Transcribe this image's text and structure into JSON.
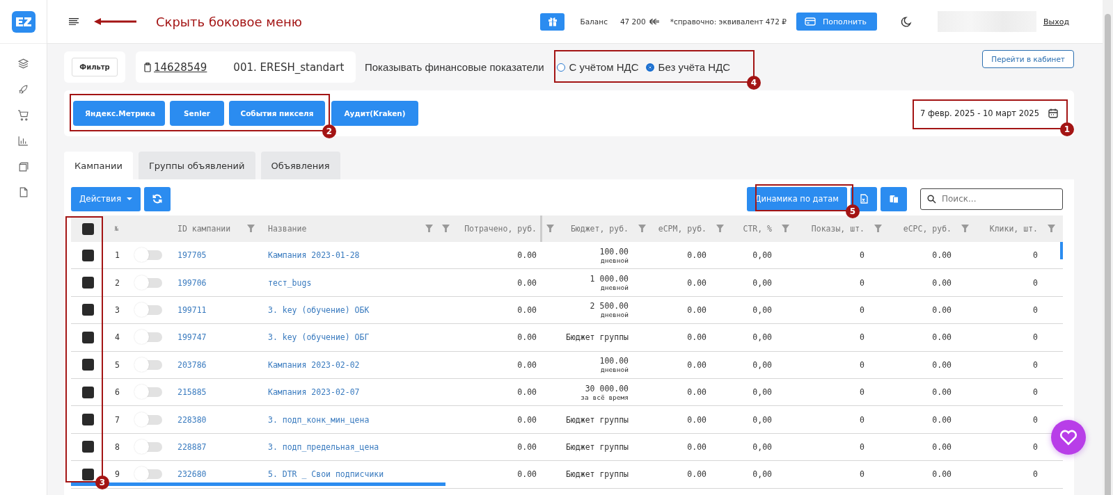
{
  "topbar": {
    "hint": "Скрыть боковое меню",
    "balance_label": "Баланс",
    "balance_value": "47 200",
    "reference_note": "*справочно: эквивалент 472 ₽",
    "topup_button": "Пополнить",
    "logout_link": "Выход"
  },
  "filter_button": "Фильтр",
  "account": {
    "id": "14628549",
    "name": "001. ERESH_standart"
  },
  "finance_display": {
    "label": "Показывать финансовые показатели",
    "options": [
      {
        "label": "С учётом НДС",
        "selected": false
      },
      {
        "label": "Без учёта НДС",
        "selected": true
      }
    ]
  },
  "cabinet_button": "Перейти в кабинет",
  "integration_buttons": [
    "Яндекс.Метрика",
    "Senler",
    "События пикселя",
    "Аудит(Kraken)"
  ],
  "date_range": "7 февр. 2025 - 10 март 2025",
  "tabs": [
    {
      "label": "Кампании",
      "selected": true
    },
    {
      "label": "Группы объявлений",
      "selected": false
    },
    {
      "label": "Объявления",
      "selected": false
    }
  ],
  "actions_button": "Действия",
  "dynamics_button": "Динамика по датам",
  "search": {
    "placeholder": "Поиск..."
  },
  "table": {
    "columns": [
      "№",
      "ID кампании",
      "Название",
      "Потрачено, руб.",
      "Бюджет, руб.",
      "eCPM, руб.",
      "CTR, %",
      "Показы, шт.",
      "eCPC, руб.",
      "Клики, шт."
    ],
    "all_checked": false,
    "rows": [
      {
        "num": "1",
        "checked": false,
        "on": false,
        "id": "197705",
        "name": "Кампания 2023-01-28",
        "spent": "0.00",
        "budget": "100.00",
        "budget_period": "дневной",
        "ecpm": "0.00",
        "ctr": "0,00",
        "shows": "0",
        "ecpc": "0.00",
        "clicks": "0"
      },
      {
        "num": "2",
        "checked": false,
        "on": false,
        "id": "199706",
        "name": "тест_bugs",
        "spent": "0.00",
        "budget": "1 000.00",
        "budget_period": "дневной",
        "ecpm": "0.00",
        "ctr": "0,00",
        "shows": "0",
        "ecpc": "0.00",
        "clicks": "0"
      },
      {
        "num": "3",
        "checked": false,
        "on": false,
        "id": "199711",
        "name": "3. key (обучение) ОБК",
        "spent": "0.00",
        "budget": "2 500.00",
        "budget_period": "дневной",
        "ecpm": "0.00",
        "ctr": "0,00",
        "shows": "0",
        "ecpc": "0.00",
        "clicks": "0"
      },
      {
        "num": "4",
        "checked": false,
        "on": false,
        "id": "199747",
        "name": "3. key (обучение) ОБГ",
        "spent": "0.00",
        "budget": "Бюджет группы",
        "ecpm": "0.00",
        "ctr": "0,00",
        "shows": "0",
        "ecpc": "0.00",
        "clicks": "0"
      },
      {
        "num": "5",
        "checked": false,
        "on": false,
        "id": "203786",
        "name": "Кампания 2023-02-02",
        "spent": "0.00",
        "budget": "100.00",
        "budget_period": "дневной",
        "ecpm": "0.00",
        "ctr": "0,00",
        "shows": "0",
        "ecpc": "0.00",
        "clicks": "0"
      },
      {
        "num": "6",
        "checked": false,
        "on": false,
        "id": "215885",
        "name": "Кампания 2023-02-07",
        "spent": "0.00",
        "budget": "30 000.00",
        "budget_period": "за всё время",
        "ecpm": "0.00",
        "ctr": "0,00",
        "shows": "0",
        "ecpc": "0.00",
        "clicks": "0"
      },
      {
        "num": "7",
        "checked": false,
        "on": false,
        "id": "228380",
        "name": "3. подп_конк_мин_цена",
        "spent": "0.00",
        "budget": "Бюджет группы",
        "ecpm": "0.00",
        "ctr": "0,00",
        "shows": "0",
        "ecpc": "0.00",
        "clicks": "0"
      },
      {
        "num": "8",
        "checked": false,
        "on": false,
        "id": "228887",
        "name": "3. подп_предельная_цена",
        "spent": "0.00",
        "budget": "Бюджет группы",
        "ecpm": "0.00",
        "ctr": "0,00",
        "shows": "0",
        "ecpc": "0.00",
        "clicks": "0"
      },
      {
        "num": "9",
        "checked": false,
        "on": false,
        "id": "232680",
        "name": "5. DTR _ Свои подписчики",
        "spent": "0.00",
        "budget": "Бюджет группы",
        "ecpm": "0.00",
        "ctr": "0,00",
        "shows": "0",
        "ecpc": "0.00",
        "clicks": "0"
      }
    ]
  },
  "annotation_markers": [
    "1",
    "2",
    "3",
    "4",
    "5"
  ]
}
